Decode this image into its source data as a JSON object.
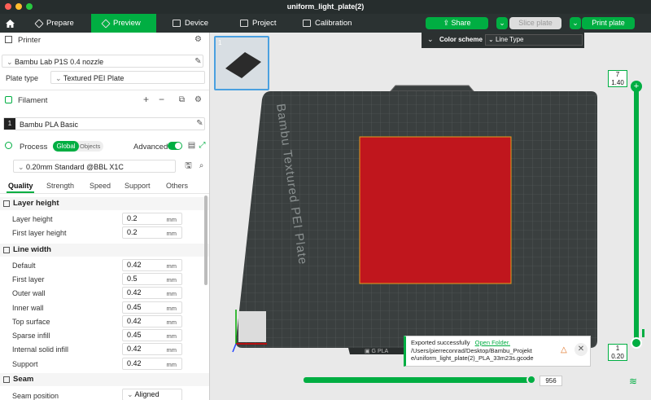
{
  "window": {
    "title": "uniform_light_plate(2)"
  },
  "topbar": {
    "tabs": [
      {
        "label": "Prepare"
      },
      {
        "label": "Preview"
      },
      {
        "label": "Device"
      },
      {
        "label": "Project"
      },
      {
        "label": "Calibration"
      }
    ],
    "share_label": "Share",
    "slice_label": "Slice plate",
    "print_label": "Print plate"
  },
  "color_scheme": {
    "label": "Color scheme",
    "value": "Line Type"
  },
  "printer": {
    "title": "Printer",
    "name": "Bambu Lab P1S 0.4 nozzle",
    "plate_type_label": "Plate type",
    "plate_type": "Textured PEI Plate"
  },
  "filament": {
    "title": "Filament",
    "slot": "1",
    "name": "Bambu PLA Basic"
  },
  "process": {
    "title": "Process",
    "toggle_global": "Global",
    "toggle_objects": "Objects",
    "advanced_label": "Advanced",
    "profile": "0.20mm Standard @BBL X1C"
  },
  "tabs": [
    "Quality",
    "Strength",
    "Speed",
    "Support",
    "Others"
  ],
  "groups": {
    "layer_height": {
      "title": "Layer height",
      "rows": [
        {
          "label": "Layer height",
          "value": "0.2",
          "unit": "mm"
        },
        {
          "label": "First layer height",
          "value": "0.2",
          "unit": "mm"
        }
      ]
    },
    "line_width": {
      "title": "Line width",
      "rows": [
        {
          "label": "Default",
          "value": "0.42",
          "unit": "mm"
        },
        {
          "label": "First layer",
          "value": "0.5",
          "unit": "mm"
        },
        {
          "label": "Outer wall",
          "value": "0.42",
          "unit": "mm"
        },
        {
          "label": "Inner wall",
          "value": "0.45",
          "unit": "mm"
        },
        {
          "label": "Top surface",
          "value": "0.42",
          "unit": "mm"
        },
        {
          "label": "Sparse infill",
          "value": "0.45",
          "unit": "mm"
        },
        {
          "label": "Internal solid infill",
          "value": "0.42",
          "unit": "mm"
        },
        {
          "label": "Support",
          "value": "0.42",
          "unit": "mm"
        }
      ]
    },
    "seam": {
      "title": "Seam",
      "rows": [
        {
          "label": "Seam position",
          "value": "Aligned"
        }
      ]
    }
  },
  "viewport": {
    "plate_thumb_number": "1",
    "plate_label": "Bambu Textured PEI Plate",
    "layer_top": {
      "number": "7",
      "height": "1.40"
    },
    "layer_bottom": {
      "number": "1",
      "height": "0.20"
    },
    "move_value": "956",
    "notification": {
      "message": "Exported successfully",
      "link": "Open Folder.",
      "path": "/Users/pierreconrad/Desktop/Bambu_Projekte/uniform_light_plate(2)_PLA_33m23s.gcode"
    },
    "colors": {
      "accent": "#00ae42",
      "object": "#c0161d",
      "plate": "#3a3f3f"
    }
  }
}
